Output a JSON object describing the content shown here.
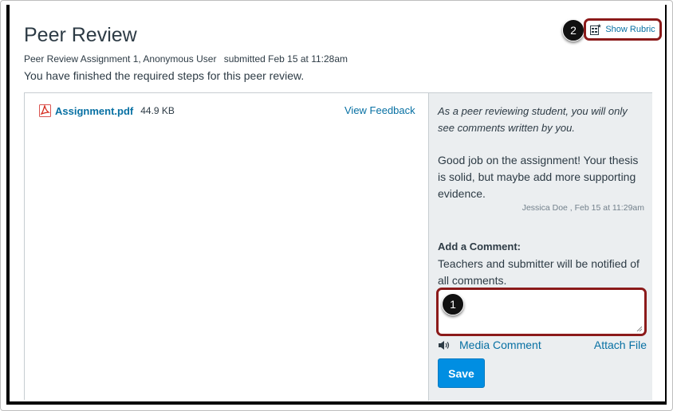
{
  "header": {
    "title": "Peer Review",
    "assignment_line": "Peer Review Assignment 1, Anonymous User",
    "submitted_line": "submitted Feb 15 at 11:28am",
    "status_message": "You have finished the required steps for this peer review.",
    "rubric_button_label": "Show Rubric",
    "rubric_icon": "rubric-icon"
  },
  "callouts": {
    "first": "1",
    "second": "2"
  },
  "document": {
    "file_name": "Assignment.pdf",
    "file_size": "44.9 KB",
    "file_icon": "pdf-icon",
    "view_feedback_label": "View Feedback"
  },
  "comments": {
    "note": "As a peer reviewing student, you will only see comments written by you.",
    "entries": [
      {
        "text": "Good job on the assignment! Your thesis is solid, but maybe add more supporting evidence.",
        "meta": "Jessica Doe , Feb 15 at 11:29am"
      }
    ],
    "add_label": "Add a Comment:",
    "notify_text": "Teachers and submitter will be notified of all comments.",
    "input_value": "",
    "media_comment_label": "Media Comment",
    "media_icon": "speaker-icon",
    "attach_file_label": "Attach File",
    "save_label": "Save"
  },
  "colors": {
    "link": "#0770a3",
    "primary_button": "#008ee2",
    "highlight": "#8b1a1a",
    "sidebar_bg": "#ebeef0"
  }
}
